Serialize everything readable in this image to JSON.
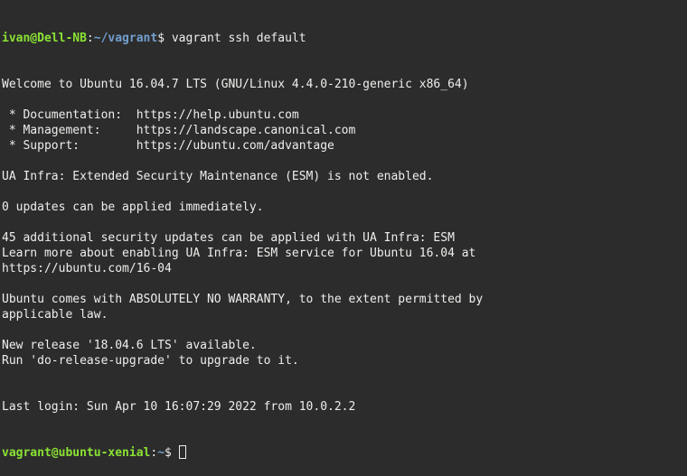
{
  "prompt1": {
    "user_host": "ivan@Dell-NB",
    "path": "~/vagrant",
    "symbol": "$ ",
    "command": "vagrant ssh default"
  },
  "lines": [
    "Welcome to Ubuntu 16.04.7 LTS (GNU/Linux 4.4.0-210-generic x86_64)",
    "",
    " * Documentation:  https://help.ubuntu.com",
    " * Management:     https://landscape.canonical.com",
    " * Support:        https://ubuntu.com/advantage",
    "",
    "UA Infra: Extended Security Maintenance (ESM) is not enabled.",
    "",
    "0 updates can be applied immediately.",
    "",
    "45 additional security updates can be applied with UA Infra: ESM",
    "Learn more about enabling UA Infra: ESM service for Ubuntu 16.04 at",
    "https://ubuntu.com/16-04",
    "",
    "Ubuntu comes with ABSOLUTELY NO WARRANTY, to the extent permitted by",
    "applicable law.",
    "",
    "New release '18.04.6 LTS' available.",
    "Run 'do-release-upgrade' to upgrade to it.",
    "",
    "",
    "Last login: Sun Apr 10 16:07:29 2022 from 10.0.2.2"
  ],
  "prompt2": {
    "user_host": "vagrant@ubuntu-xenial",
    "path": "~",
    "symbol": "$ "
  }
}
